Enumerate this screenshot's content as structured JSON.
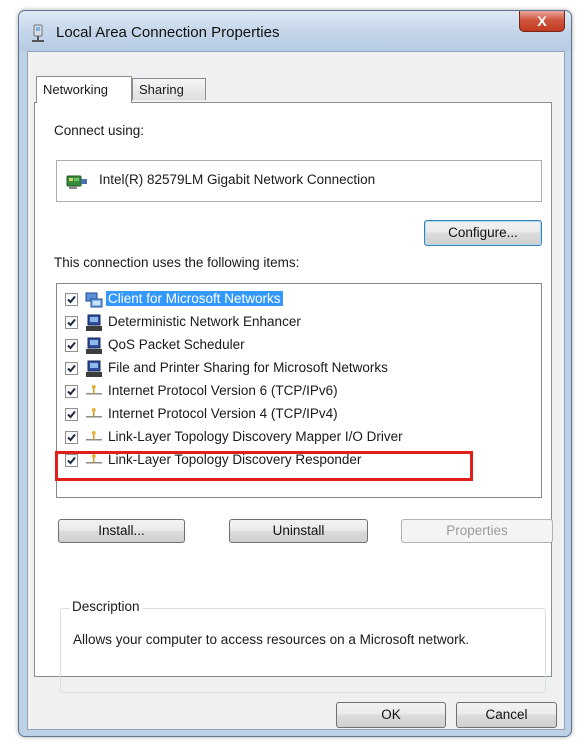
{
  "window": {
    "title": "Local Area Connection Properties",
    "close_label": "X"
  },
  "tabs": [
    {
      "label": "Networking",
      "active": true
    },
    {
      "label": "Sharing",
      "active": false
    }
  ],
  "connect_using": {
    "label": "Connect using:",
    "adapter": "Intel(R) 82579LM Gigabit Network Connection",
    "adapter_icon": "network-adapter-icon"
  },
  "configure_label": "Configure...",
  "items_label": "This connection uses the following items:",
  "items": [
    {
      "label": "Client for Microsoft Networks",
      "checked": true,
      "selected": true,
      "icon": "client-network-icon"
    },
    {
      "label": "Deterministic Network Enhancer",
      "checked": true,
      "selected": false,
      "icon": "service-icon"
    },
    {
      "label": "QoS Packet Scheduler",
      "checked": true,
      "selected": false,
      "icon": "service-icon"
    },
    {
      "label": "File and Printer Sharing for Microsoft Networks",
      "checked": true,
      "selected": false,
      "icon": "service-icon"
    },
    {
      "label": "Internet Protocol Version 6 (TCP/IPv6)",
      "checked": true,
      "selected": false,
      "icon": "protocol-icon"
    },
    {
      "label": "Internet Protocol Version 4 (TCP/IPv4)",
      "checked": true,
      "selected": false,
      "icon": "protocol-icon",
      "highlighted": true
    },
    {
      "label": "Link-Layer Topology Discovery Mapper I/O Driver",
      "checked": true,
      "selected": false,
      "icon": "protocol-icon"
    },
    {
      "label": "Link-Layer Topology Discovery Responder",
      "checked": true,
      "selected": false,
      "icon": "protocol-icon"
    }
  ],
  "buttons": {
    "install": "Install...",
    "uninstall": "Uninstall",
    "properties": "Properties",
    "ok": "OK",
    "cancel": "Cancel"
  },
  "description": {
    "title": "Description",
    "text": "Allows your computer to access resources on a Microsoft network."
  },
  "colors": {
    "selection": "#3399ff",
    "highlight_border": "#e0201b",
    "window_frame": "#bcd1e6"
  }
}
